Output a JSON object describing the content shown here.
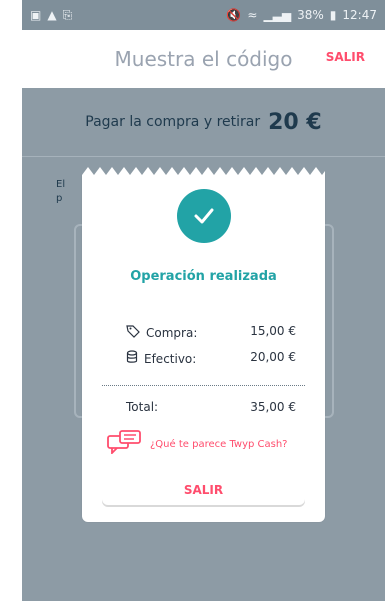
{
  "status_bar": {
    "left_icons": [
      "image-icon",
      "warning-icon",
      "cast-icon"
    ],
    "right_icons": [
      "mute-icon",
      "wifi-icon",
      "signal-icon",
      "battery-icon"
    ],
    "battery": "38%",
    "time": "12:47"
  },
  "header": {
    "title": "Muestra el código",
    "exit_label": "SALIR"
  },
  "summary": {
    "label": "Pagar la compra y retirar",
    "amount": "20 €"
  },
  "background": {
    "partial_line_1": "El",
    "partial_line_2": "p"
  },
  "modal": {
    "icon": "check-icon",
    "title": "Operación realizada",
    "purchase": {
      "icon": "tag-icon",
      "label": "Compra:",
      "value": "15,00 €"
    },
    "cash": {
      "icon": "coins-icon",
      "label": "Efectivo:",
      "value": "20,00 €"
    },
    "total": {
      "label": "Total:",
      "value": "35,00 €"
    },
    "feedback": {
      "icon": "chat-icon",
      "text": "¿Qué te parece Twyp Cash?"
    },
    "exit_button": "SALIR"
  },
  "colors": {
    "accent": "#22a3a6",
    "danger": "#ff4d6d",
    "backdrop": "#8d9ba5"
  }
}
